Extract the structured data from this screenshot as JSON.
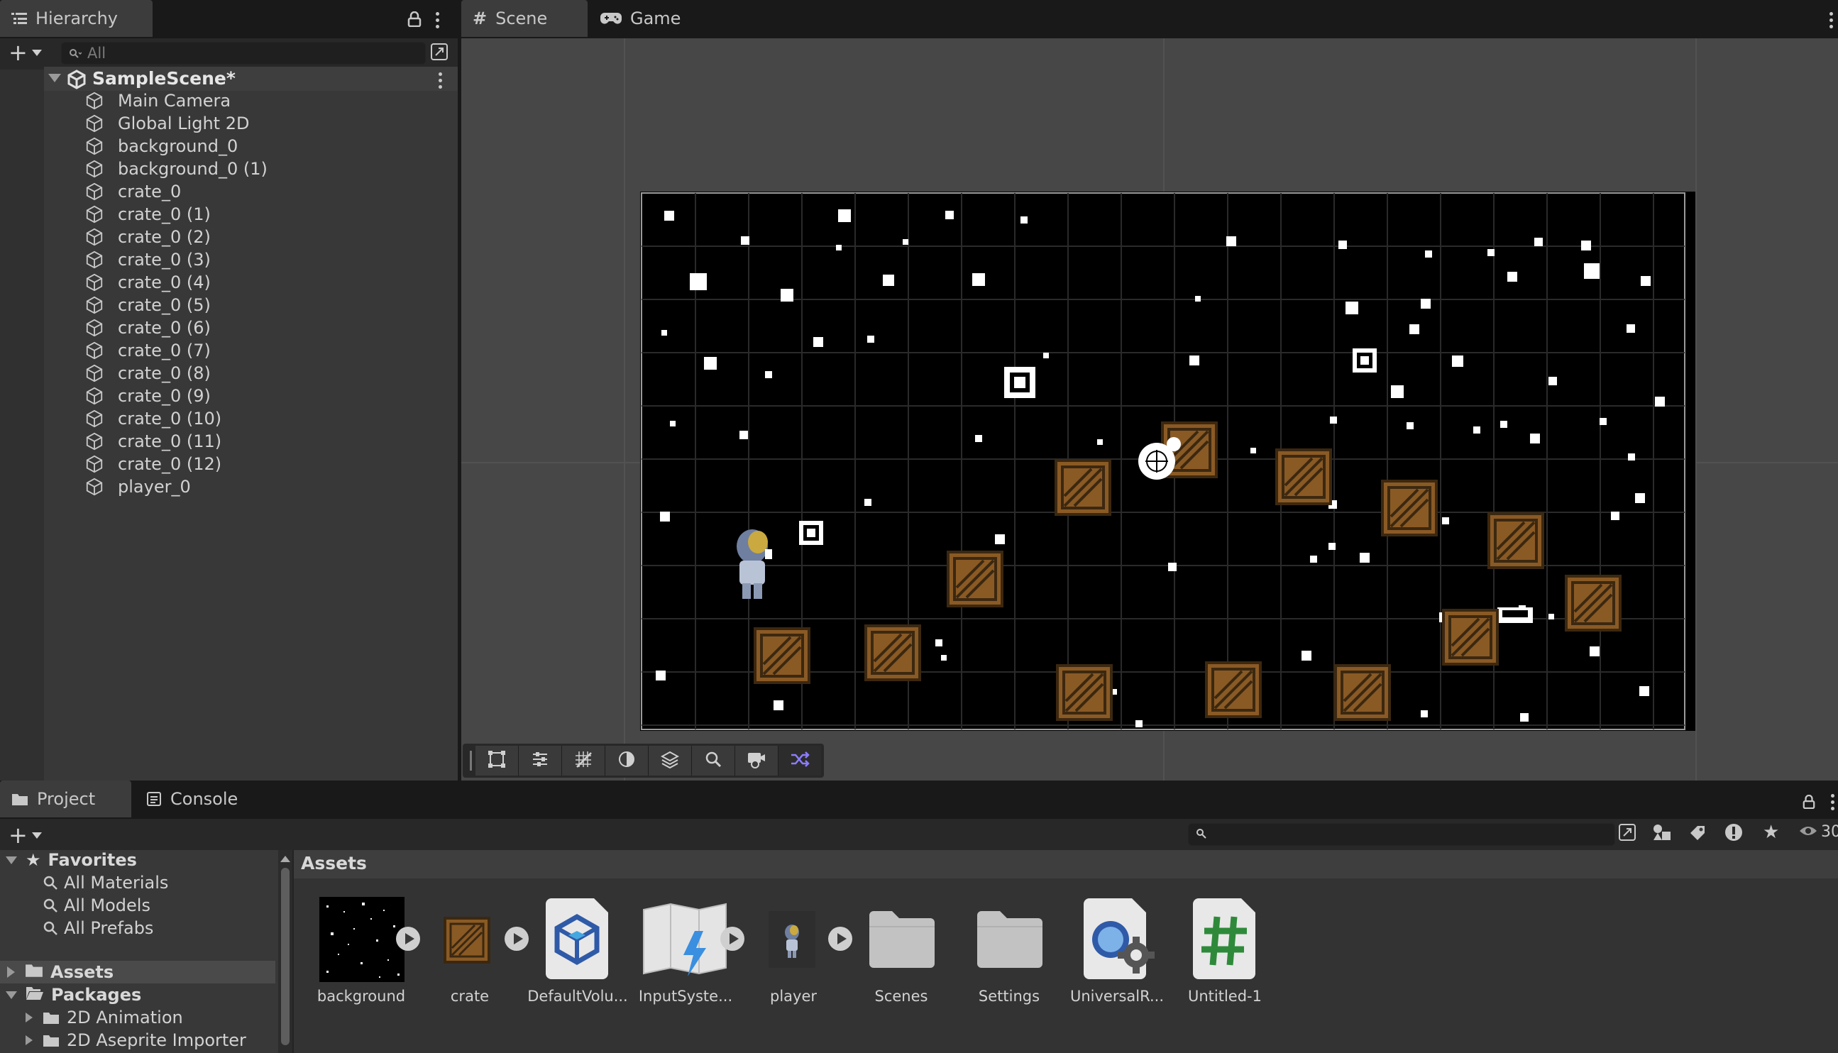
{
  "hierarchy": {
    "tab_label": "Hierarchy",
    "search_placeholder": "All",
    "scene_name": "SampleScene*",
    "items": [
      "Main Camera",
      "Global Light 2D",
      "background_0",
      "background_0 (1)",
      "crate_0",
      "crate_0 (1)",
      "crate_0 (2)",
      "crate_0 (3)",
      "crate_0 (4)",
      "crate_0 (5)",
      "crate_0 (6)",
      "crate_0 (7)",
      "crate_0 (8)",
      "crate_0 (9)",
      "crate_0 (10)",
      "crate_0 (11)",
      "crate_0 (12)",
      "player_0"
    ]
  },
  "scene_view": {
    "tabs": [
      {
        "label": "Scene",
        "icon": "hash-icon"
      },
      {
        "label": "Game",
        "icon": "gamepad-icon"
      }
    ],
    "tools": [
      "rect-tool-icon",
      "transform-settings-icon",
      "grid-snap-icon",
      "shading-mode-icon",
      "layers-icon",
      "zoom-icon",
      "scene-camera-icon",
      "shuffle-icon"
    ]
  },
  "project": {
    "tabs": [
      {
        "label": "Project",
        "icon": "folder-icon"
      },
      {
        "label": "Console",
        "icon": "console-icon"
      }
    ],
    "favorites_label": "Favorites",
    "favorites": [
      "All Materials",
      "All Models",
      "All Prefabs"
    ],
    "assets_label": "Assets",
    "packages_label": "Packages",
    "packages": [
      "2D Animation",
      "2D Aseprite Importer"
    ],
    "breadcrumb": "Assets",
    "visible_count": "30",
    "assets": [
      {
        "label": "background",
        "kind": "sprite-background"
      },
      {
        "label": "crate",
        "kind": "sprite-crate"
      },
      {
        "label": "DefaultVolu...",
        "kind": "volume-profile"
      },
      {
        "label": "InputSyste...",
        "kind": "input-actions"
      },
      {
        "label": "player",
        "kind": "sprite-player"
      },
      {
        "label": "Scenes",
        "kind": "folder"
      },
      {
        "label": "Settings",
        "kind": "folder"
      },
      {
        "label": "UniversalR...",
        "kind": "render-pipeline-asset"
      },
      {
        "label": "Untitled-1",
        "kind": "script"
      }
    ]
  },
  "colors": {
    "accent": "#7d6cff",
    "panel": "#383838",
    "dark": "#191919",
    "crate": "#8a5a25"
  }
}
